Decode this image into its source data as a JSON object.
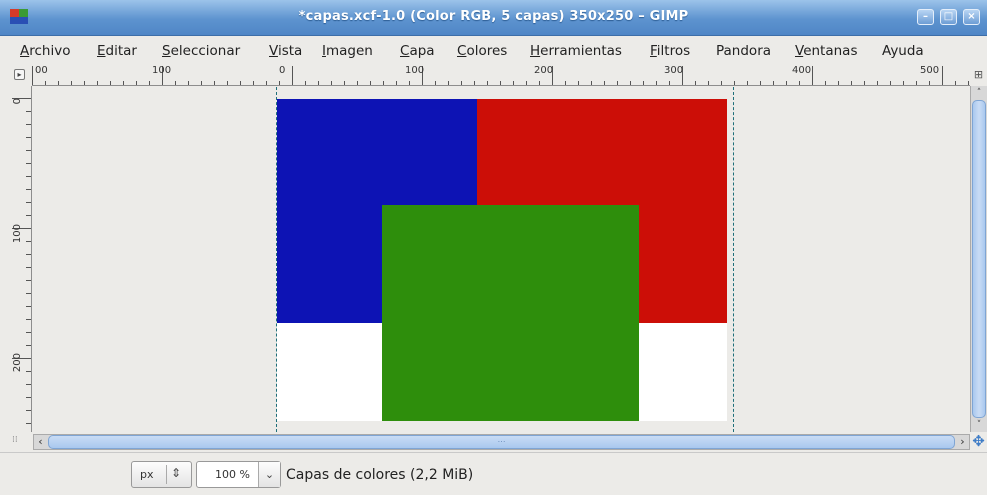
{
  "window": {
    "title": "*capas.xcf-1.0 (Color RGB, 5 capas) 350x250 – GIMP",
    "buttons": {
      "minimize": "–",
      "maximize": "□",
      "close": "×"
    }
  },
  "menu": [
    {
      "label": "Archivo",
      "key": "A",
      "rest": "rchivo"
    },
    {
      "label": "Editar",
      "key": "E",
      "rest": "ditar"
    },
    {
      "label": "Seleccionar",
      "key": "S",
      "rest": "eleccionar"
    },
    {
      "label": "Vista",
      "key": "V",
      "rest": "ista"
    },
    {
      "label": "Imagen",
      "key": "I",
      "rest": "magen"
    },
    {
      "label": "Capa",
      "key": "C",
      "rest": "apa"
    },
    {
      "label": "Colores",
      "key": "C",
      "rest": "olores"
    },
    {
      "label": "Herramientas",
      "key": "H",
      "rest": "erramientas"
    },
    {
      "label": "Filtros",
      "key": "F",
      "rest": "iltros"
    },
    {
      "label": "Pandora",
      "key": "",
      "rest": "Pandora"
    },
    {
      "label": "Ventanas",
      "key": "V",
      "rest": "entanas"
    },
    {
      "label": "Ayuda",
      "key": "",
      "rest": "Ayuda"
    }
  ],
  "rulers": {
    "horizontal_labels": [
      "00",
      "100",
      "0",
      "100",
      "200",
      "300",
      "400",
      "500"
    ],
    "vertical_labels": [
      "0",
      "100",
      "200"
    ]
  },
  "layers": [
    {
      "name": "blue",
      "color": "#0d13b4"
    },
    {
      "name": "red",
      "color": "#cc0e07"
    },
    {
      "name": "green",
      "color": "#2e8e0c"
    }
  ],
  "image": {
    "background": "#ffffff"
  },
  "statusbar": {
    "unit": "px",
    "zoom": "100 %",
    "zoom_button": "⌄",
    "message": "Capas de colores (2,2 MiB)"
  },
  "icons": {
    "nav": "⊞",
    "move": "✥",
    "scroll_left": "‹",
    "scroll_right": "›",
    "scroll_up": "˄",
    "scroll_down": "˅",
    "quickmask": "⁞⁞",
    "corner": "▸",
    "grip": "⋯"
  },
  "colors": {
    "titlebar": "#5d93cf",
    "guide": "#1f6f7a",
    "canvas_bg": "#ecebe8"
  }
}
